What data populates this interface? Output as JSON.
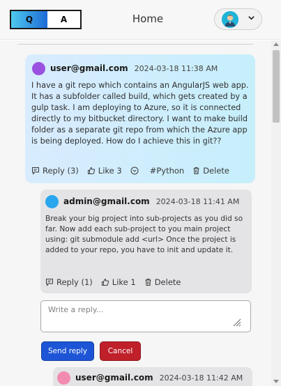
{
  "header": {
    "toggle_q": "Q",
    "toggle_a": "A",
    "title": "Home",
    "user_menu_icon": "user-avatar-icon",
    "chevron_icon": "chevron-down-icon"
  },
  "question": {
    "avatar_color": "#9b51e0",
    "email": "user@gmail.com",
    "timestamp": "2024-03-18 11:38 AM",
    "body": "I have a git repo which contains an AngularJS web app. It has a subfolder called build, which gets created by a gulp task. I am deploying to Azure, so it is connected directly to my bitbucket directory. I want to make build folder as a separate git repo from which the Azure app is being deployed. How do I achieve this in git??",
    "reply_label": "Reply (3)",
    "like_label": "Like 3",
    "tag": "#Python",
    "delete_label": "Delete"
  },
  "answer": {
    "avatar_color": "#2aa6ee",
    "email": "admin@gmail.com",
    "timestamp": "2024-03-18 11:41 AM",
    "body": "Break your big project into sub-projects as you did so far. Now add each sub-project to you main project using: git submodule add <url> Once the project is added to your repo, you have to init and update it.",
    "reply_label": "Reply (1)",
    "like_label": "Like 1",
    "delete_label": "Delete"
  },
  "reply_form": {
    "placeholder": "Write a reply...",
    "send_label": "Send reply",
    "cancel_label": "Cancel",
    "send_color": "#1d55d6",
    "cancel_color": "#c0202a"
  },
  "nested_reply": {
    "avatar_color": "#f28bb0",
    "email": "user@gmail.com",
    "timestamp": "2024-03-18 11:42 AM"
  }
}
